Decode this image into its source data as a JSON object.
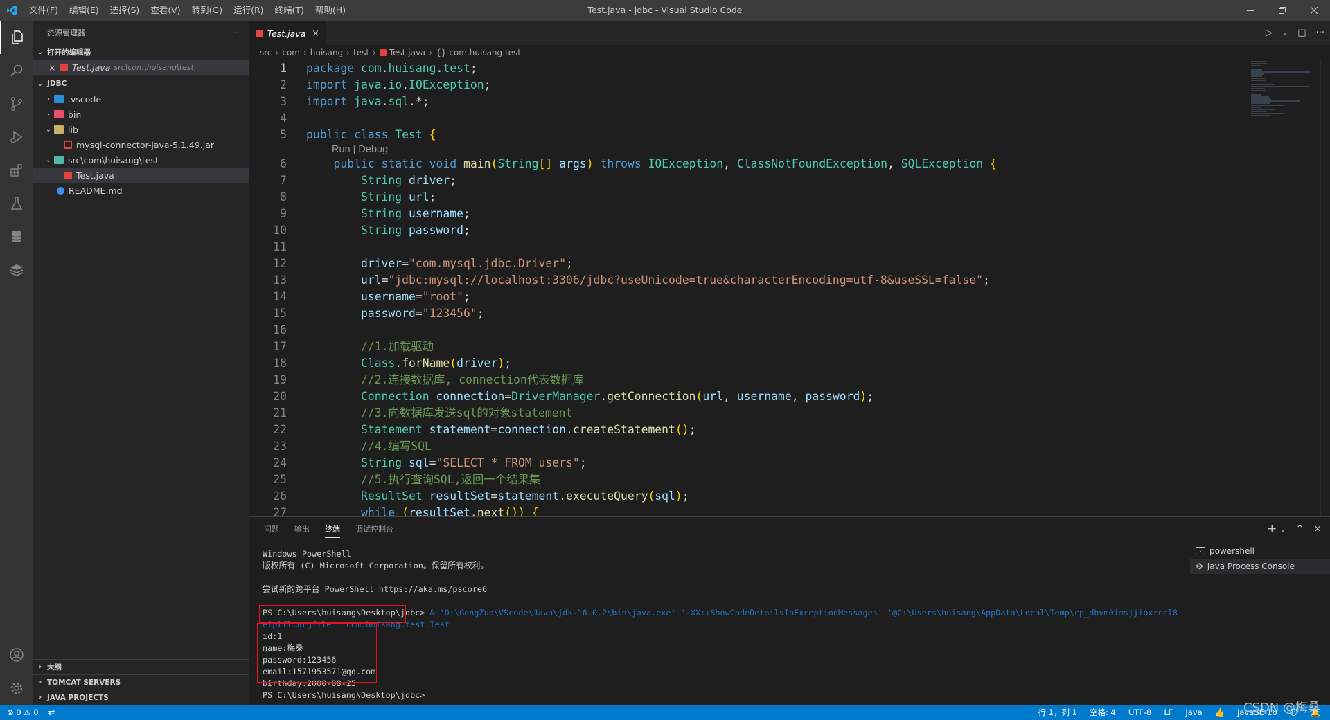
{
  "window": {
    "title": "Test.java - jdbc - Visual Studio Code",
    "menu": [
      "文件(F)",
      "编辑(E)",
      "选择(S)",
      "查看(V)",
      "转到(G)",
      "运行(R)",
      "终端(T)",
      "帮助(H)"
    ]
  },
  "sidebar": {
    "title": "资源管理器",
    "more": "···",
    "open_editors": {
      "label": "打开的编辑器",
      "file": "Test.java",
      "file_path": "src\\com\\huisang\\test",
      "close": "×"
    },
    "workspace": {
      "label": "JDBC",
      "items": [
        {
          "label": ".vscode",
          "type": "folder"
        },
        {
          "label": "bin",
          "type": "folder"
        },
        {
          "label": "lib",
          "type": "folder"
        },
        {
          "label": "mysql-connector-java-5.1.49.jar",
          "type": "jar"
        },
        {
          "label": "src\\com\\huisang\\test",
          "type": "folder"
        },
        {
          "label": "Test.java",
          "type": "java"
        },
        {
          "label": "README.md",
          "type": "info"
        }
      ]
    },
    "bottom_sections": [
      "大纲",
      "TOMCAT SERVERS",
      "JAVA PROJECTS"
    ]
  },
  "editor": {
    "tab": {
      "label": "Test.java",
      "close": "×"
    },
    "breadcrumb": [
      "src",
      "com",
      "huisang",
      "test",
      "Test.java",
      "{} com.huisang.test"
    ],
    "code_lens": "Run | Debug",
    "lines": [
      {
        "n": "1",
        "t": "package com.huisang.test;"
      },
      {
        "n": "2",
        "t": "import java.io.IOException;"
      },
      {
        "n": "3",
        "t": "import java.sql.*;"
      },
      {
        "n": "4",
        "t": ""
      },
      {
        "n": "5",
        "t": "public class Test {"
      },
      {
        "n": "6",
        "t": "    public static void main(String[] args) throws IOException, ClassNotFoundException, SQLException {"
      },
      {
        "n": "7",
        "t": "        String driver;"
      },
      {
        "n": "8",
        "t": "        String url;"
      },
      {
        "n": "9",
        "t": "        String username;"
      },
      {
        "n": "10",
        "t": "        String password;"
      },
      {
        "n": "11",
        "t": ""
      },
      {
        "n": "12",
        "t": "        driver=\"com.mysql.jdbc.Driver\";"
      },
      {
        "n": "13",
        "t": "        url=\"jdbc:mysql://localhost:3306/jdbc?useUnicode=true&characterEncoding=utf-8&useSSL=false\";"
      },
      {
        "n": "14",
        "t": "        username=\"root\";"
      },
      {
        "n": "15",
        "t": "        password=\"123456\";"
      },
      {
        "n": "16",
        "t": ""
      },
      {
        "n": "17",
        "t": "        //1.加载驱动"
      },
      {
        "n": "18",
        "t": "        Class.forName(driver);"
      },
      {
        "n": "19",
        "t": "        //2.连接数据库, connection代表数据库"
      },
      {
        "n": "20",
        "t": "        Connection connection=DriverManager.getConnection(url, username, password);"
      },
      {
        "n": "21",
        "t": "        //3.向数据库发送sql的对象statement"
      },
      {
        "n": "22",
        "t": "        Statement statement=connection.createStatement();"
      },
      {
        "n": "23",
        "t": "        //4.编写SQL"
      },
      {
        "n": "24",
        "t": "        String sql=\"SELECT * FROM users\";"
      },
      {
        "n": "25",
        "t": "        //5.执行查询SQL,返回一个结果集"
      },
      {
        "n": "26",
        "t": "        ResultSet resultSet=statement.executeQuery(sql);"
      },
      {
        "n": "27",
        "t": "        while (resultSet.next()) {"
      }
    ]
  },
  "panel": {
    "tabs": [
      "问题",
      "输出",
      "终端",
      "调试控制台"
    ],
    "active_tab": "终端",
    "actions": {
      "add": "+",
      "dropdown": "⌄",
      "maximize": "⌃",
      "close": "×"
    },
    "terminal_lines": [
      "Windows PowerShell",
      "版权所有 (C) Microsoft Corporation。保留所有权利。",
      "",
      "尝试新的跨平台 PowerShell https://aka.ms/pscore6",
      ""
    ],
    "prompt": "PS C:\\Users\\huisang\\Desktop\\jdbc>",
    "command": " & 'D:\\GongZuo\\VScode\\Java\\jdk-16.0.2\\bin\\java.exe' '-XX:+ShowCodeDetailsInExceptionMessages' '@C:\\Users\\huisang\\AppData\\Local\\Temp\\cp_dbvm0imsjjioxrcel8e",
    "command_cont": "eiplfl.argfile' 'com.huisang.test.Test'",
    "output": [
      "id:1",
      "name:梅桑",
      "password:123456",
      "email:1571953571@qq.com",
      "birthday:2000-08-25"
    ],
    "final_prompt": "PS C:\\Users\\huisang\\Desktop\\jdbc>",
    "terminal_list": [
      "powershell",
      "Java Process Console"
    ]
  },
  "statusbar": {
    "errors": "0",
    "warnings": "0",
    "position": "行 1，列 1",
    "spaces": "空格: 4",
    "encoding": "UTF-8",
    "eol": "LF",
    "language": "Java",
    "jdk": "JavaSE-16"
  },
  "watermark": "CSDN @梅桑",
  "colors": {
    "accent": "#007acc",
    "titlebar": "#3c3c3c",
    "sidebar": "#252526",
    "editor": "#1e1e1e",
    "highlight_box": "#e81123"
  }
}
